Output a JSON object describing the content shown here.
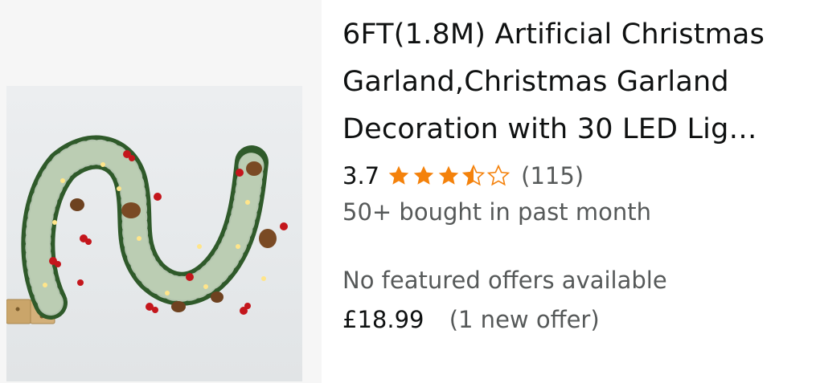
{
  "product": {
    "title_line1": "6FT(1.8M) Artificial Christmas",
    "title_line2": "Garland,Christmas Garland",
    "title_line3": "Decoration with 30 LED Lig…",
    "rating_value": "3.7",
    "rating_fraction": 0.74,
    "review_count": "(115)",
    "bought_text": "50+ bought in past month",
    "offers_text": "No featured offers available",
    "price": "£18.99",
    "new_offer_text": "(1 new offer)"
  },
  "colors": {
    "star": "#f4820c",
    "text_primary": "#0f1111",
    "text_secondary": "#565959",
    "image_panel_bg": "#f6f6f6"
  },
  "icons": {
    "star_full": "star-full-icon",
    "star_half": "star-half-icon",
    "star_empty": "star-empty-icon"
  }
}
